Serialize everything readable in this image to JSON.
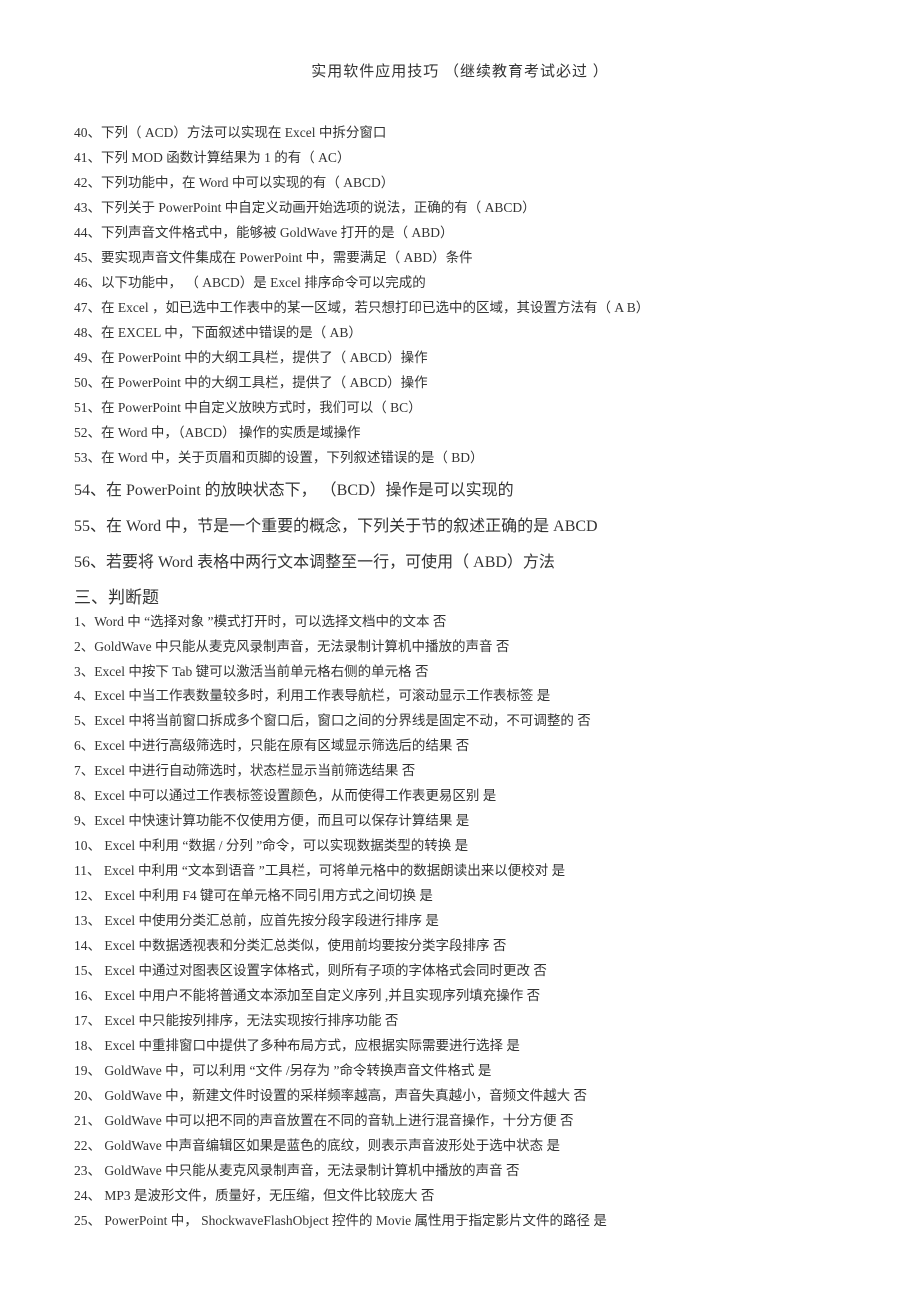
{
  "title": "实用软件应用技巧    （继续教育考试必过   ）",
  "mc": [
    "40、下列（ ACD）方法可以实现在    Excel 中拆分窗口",
    "41、下列 MOD 函数计算结果为     1 的有（ AC）",
    "42、下列功能中，在    Word 中可以实现的有（  ABCD）",
    "43、下列关于 PowerPoint   中自定义动画开始选项的说法，正确的有（       ABCD）",
    "44、下列声音文件格式中，能够被       GoldWave  打开的是（ ABD）",
    "45、要实现声音文件集成在      PowerPoint  中，需要满足（  ABD）条件",
    "46、以下功能中，  （ ABCD）是 Excel 排序命令可以完成的",
    "47、在 Excel ，如已选中工作表中的某一区域，若只想打印已选中的区域，其设置方法有（          A B）",
    "48、在 EXCEL  中，下面叙述中错误的是（  AB）",
    "49、在 PowerPoint    中的大纲工具栏，提供了（     ABCD）操作",
    "50、在 PowerPoint    中的大纲工具栏，提供了（     ABCD）操作",
    "51、在 PowerPoint    中自定义放映方式时，我们可以（      BC）",
    "52、在 Word 中，（ABCD）  操作的实质是域操作",
    "53、在 Word 中，关于页眉和页脚的设置，下列叙述错误的是（        BD）"
  ],
  "big": [
    "54、在 PowerPoint 的放映状态下，   （BCD）操作是可以实现的",
    "55、在 Word 中，节是一个重要的概念，下列关于节的叙述正确的是              ABCD",
    "56、若要将  Word 表格中两行文本调整至一行，可使用（       ABD）方法"
  ],
  "section_heading": "三、判断题",
  "tf": [
    "1、Word 中 “选择对象  ”模式打开时，可以选择文档中的文本                否",
    "2、GoldWave  中只能从麦克风录制声音，无法录制计算机中播放的声音              否",
    "3、Excel 中按下 Tab 键可以激活当前单元格右侧的单元格           否",
    "4、Excel 中当工作表数量较多时，利用工作表导航栏，可滚动显示工作表标签             是",
    "5、Excel 中将当前窗口拆成多个窗口后，窗口之间的分界线是固定不动，不可调整的                   否",
    "6、Excel 中进行高级筛选时，只能在原有区域显示筛选后的结果             否",
    "7、Excel 中进行自动筛选时，状态栏显示当前筛选结果          否",
    "8、Excel 中可以通过工作表标签设置颜色，从而使得工作表更易区别             是",
    "9、Excel 中快速计算功能不仅使用方便，而且可以保存计算结果           是",
    "10、 Excel 中利用  “数据 / 分列 ”命令，可以实现数据类型的转换      是",
    "11、 Excel 中利用 “文本到语音  ”工具栏，可将单元格中的数据朗读出来以便校对       是",
    "12、 Excel 中利用 F4 键可在单元格不同引用方式之间切换           是",
    "13、 Excel 中使用分类汇总前，应首先按分段字段进行排序            是",
    "14、 Excel 中数据透视表和分类汇总类似，使用前均要按分类字段排序               否",
    "15、 Excel 中通过对图表区设置字体格式，则所有子项的字体格式会同时更改              否",
    "16、 Excel 中用户不能将普通文本添加至自定义序列      ,并且实现序列填充操作      否",
    "17、 Excel 中只能按列排序，无法实现按行排序功能          否",
    "18、 Excel 中重排窗口中提供了多种布局方式，应根据实际需要进行选择              是",
    "19、 GoldWave  中，可以利用   “文件 /另存为 ”命令转换声音文件格式      是",
    "20、 GoldWave  中，新建文件时设置的采样频率越高，声音失真越小，音频文件越大                  否",
    "21、 GoldWave  中可以把不同的声音放置在不同的音轨上进行混音操作，十分方便                  否",
    "22、 GoldWave  中声音编辑区如果是蓝色的底纹，则表示声音波形处于选中状态               是",
    "23、 GoldWave  中只能从麦克风录制声音，无法录制计算机中播放的声音               否",
    "24、 MP3 是波形文件，质量好，无压缩，但文件比较庞大            否",
    "25、 PowerPoint  中， ShockwaveFlashObject   控件的 Movie 属性用于指定影片文件的路径          是"
  ]
}
